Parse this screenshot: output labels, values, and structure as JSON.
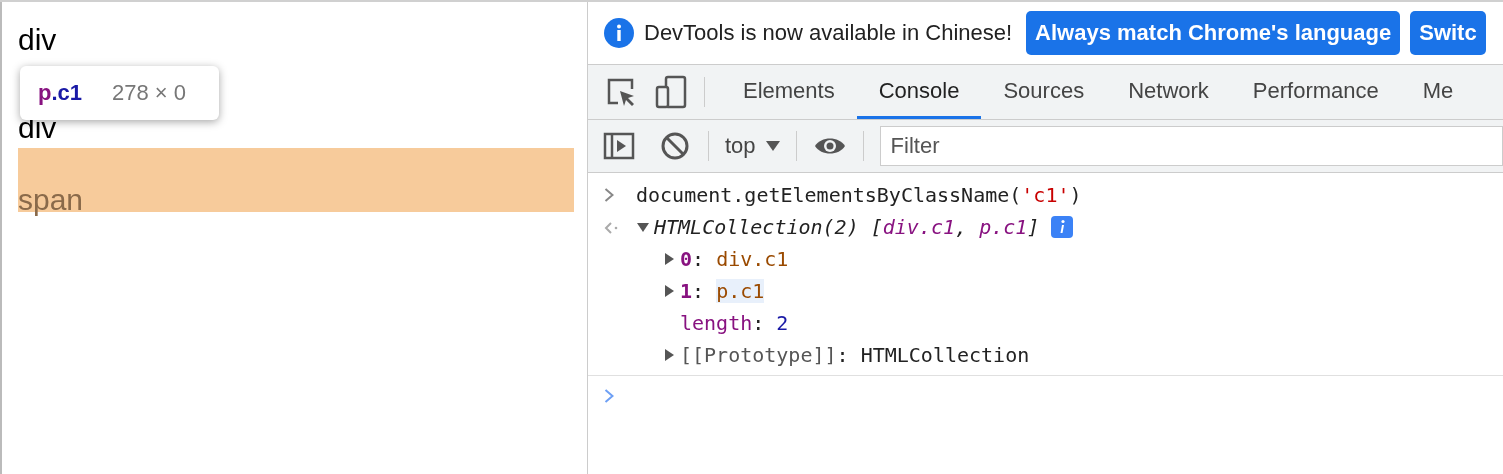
{
  "page": {
    "texts": [
      "div",
      "div"
    ],
    "highlighted_text": "span",
    "tooltip": {
      "tag": "p",
      "class_name": ".c1",
      "size": "278 × 0"
    }
  },
  "devtools": {
    "infobar": {
      "message": "DevTools is now available in Chinese!",
      "buttons": [
        "Always match Chrome's language",
        "Switc"
      ]
    },
    "tabs": [
      {
        "label": "Elements",
        "selected": false
      },
      {
        "label": "Console",
        "selected": true
      },
      {
        "label": "Sources",
        "selected": false
      },
      {
        "label": "Network",
        "selected": false
      },
      {
        "label": "Performance",
        "selected": false
      },
      {
        "label": "Me",
        "selected": false
      }
    ],
    "toolbar": {
      "context": "top",
      "filter_placeholder": "Filter"
    },
    "console": {
      "input": {
        "code": "document.getElementsByClassName(",
        "string": "'c1'",
        "close": ")"
      },
      "result": {
        "expanded": true,
        "summary": [
          {
            "kind": "plain",
            "text": "HTMLCollection(2) ["
          },
          {
            "kind": "item",
            "text": "div.c1"
          },
          {
            "kind": "plain",
            "text": ", "
          },
          {
            "kind": "item",
            "text": "p.c1"
          },
          {
            "kind": "plain",
            "text": "]"
          }
        ],
        "properties": [
          {
            "kind": "index",
            "key": "0",
            "separator": ":",
            "value": "div.c1",
            "highlighted": false
          },
          {
            "kind": "index",
            "key": "1",
            "separator": ":",
            "value": "p.c1",
            "highlighted": true
          },
          {
            "kind": "number",
            "key": "length",
            "separator": ":",
            "value": "2",
            "highlighted": false
          },
          {
            "kind": "internal",
            "key": "[[Prototype]]",
            "separator": ":",
            "value": "HTMLCollection",
            "highlighted": false
          }
        ]
      }
    }
  }
}
